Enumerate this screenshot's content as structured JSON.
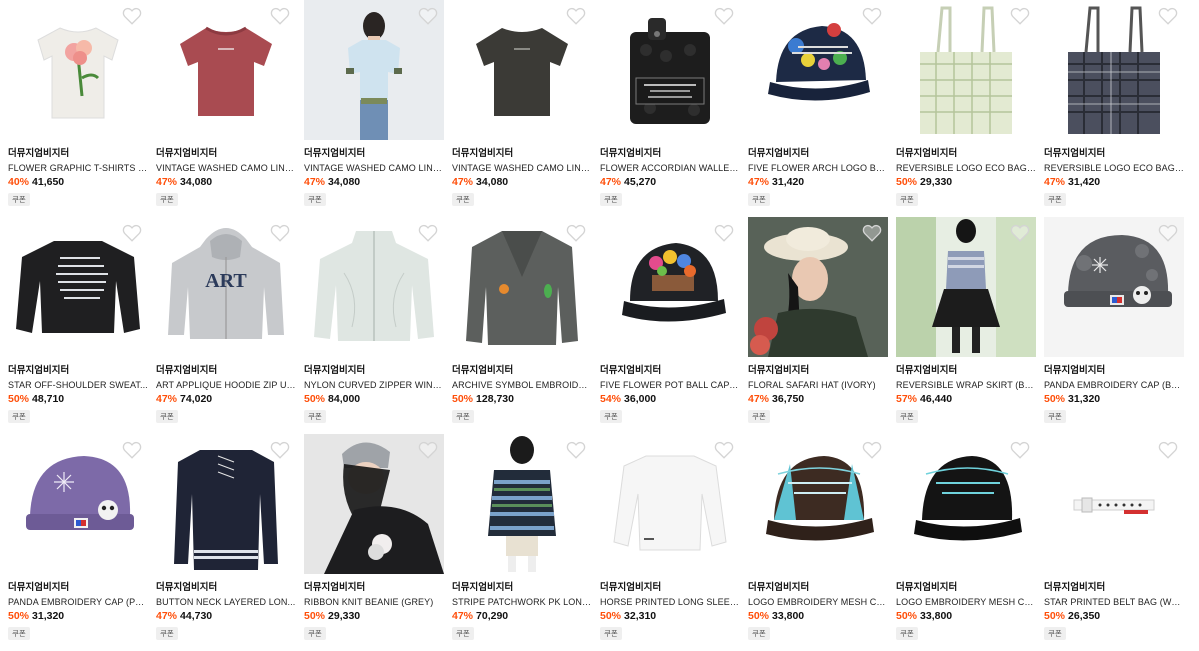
{
  "coupon_label": "쿠폰",
  "products": [
    {
      "brand": "더뮤지엄비지터",
      "name": "FLOWER GRAPHIC T-SHIRTS (...",
      "discount": "40%",
      "price": "41,650",
      "art": "tee-flower"
    },
    {
      "brand": "더뮤지엄비지터",
      "name": "VINTAGE WASHED CAMO LINE...",
      "discount": "47%",
      "price": "34,080",
      "art": "tee-red"
    },
    {
      "brand": "더뮤지엄비지터",
      "name": "VINTAGE WASHED CAMO LINE...",
      "discount": "47%",
      "price": "34,080",
      "art": "model-tee"
    },
    {
      "brand": "더뮤지엄비지터",
      "name": "VINTAGE WASHED CAMO LINE...",
      "discount": "47%",
      "price": "34,080",
      "art": "tee-charcoal"
    },
    {
      "brand": "더뮤지엄비지터",
      "name": "FLOWER ACCORDIAN WALLET...",
      "discount": "47%",
      "price": "45,270",
      "art": "wallet"
    },
    {
      "brand": "더뮤지엄비지터",
      "name": "FIVE FLOWER ARCH LOGO BA...",
      "discount": "47%",
      "price": "31,420",
      "art": "cap-navy-flowers"
    },
    {
      "brand": "더뮤지엄비지터",
      "name": "REVERSIBLE LOGO ECO BAG (...",
      "discount": "50%",
      "price": "29,330",
      "art": "bag-green"
    },
    {
      "brand": "더뮤지엄비지터",
      "name": "REVERSIBLE LOGO ECO BAG (...",
      "discount": "47%",
      "price": "31,420",
      "art": "bag-navy"
    },
    {
      "brand": "더뮤지엄비지터",
      "name": "STAR OFF-SHOULDER SWEAT...",
      "discount": "50%",
      "price": "48,710",
      "art": "sweat-black"
    },
    {
      "brand": "더뮤지엄비지터",
      "name": "ART APPLIQUE HOODIE ZIP UP...",
      "discount": "47%",
      "price": "74,020",
      "art": "hoodie-art"
    },
    {
      "brand": "더뮤지엄비지터",
      "name": "NYLON CURVED ZIPPER WIND...",
      "discount": "50%",
      "price": "84,000",
      "art": "jacket-mint"
    },
    {
      "brand": "더뮤지엄비지터",
      "name": "ARCHIVE SYMBOL EMBROIDE...",
      "discount": "50%",
      "price": "128,730",
      "art": "blazer"
    },
    {
      "brand": "더뮤지엄비지터",
      "name": "FIVE FLOWER POT BALL CAP (...",
      "discount": "54%",
      "price": "36,000",
      "art": "cap-flowerpot"
    },
    {
      "brand": "더뮤지엄비지터",
      "name": "FLORAL SAFARI HAT (IVORY)",
      "discount": "47%",
      "price": "36,750",
      "art": "model-hat"
    },
    {
      "brand": "더뮤지엄비지터",
      "name": "REVERSIBLE WRAP SKIRT (BLA...",
      "discount": "57%",
      "price": "46,440",
      "art": "model-skirt"
    },
    {
      "brand": "더뮤지엄비지터",
      "name": "PANDA EMBROIDERY CAP (BL...",
      "discount": "50%",
      "price": "31,320",
      "art": "cap-panda-grey"
    },
    {
      "brand": "더뮤지엄비지터",
      "name": "PANDA EMBROIDERY CAP (PU...",
      "discount": "50%",
      "price": "31,320",
      "art": "cap-panda-purple"
    },
    {
      "brand": "더뮤지엄비지터",
      "name": "BUTTON NECK LAYERED LON...",
      "discount": "47%",
      "price": "44,730",
      "art": "longsleeve-navy"
    },
    {
      "brand": "더뮤지엄비지터",
      "name": "RIBBON KNIT BEANIE (GREY)",
      "discount": "50%",
      "price": "29,330",
      "art": "model-beanie"
    },
    {
      "brand": "더뮤지엄비지터",
      "name": "STRIPE PATCHWORK PK LONG...",
      "discount": "47%",
      "price": "70,290",
      "art": "model-stripe"
    },
    {
      "brand": "더뮤지엄비지터",
      "name": "HORSE PRINTED LONG SLEEV...",
      "discount": "50%",
      "price": "32,310",
      "art": "longsleeve-white"
    },
    {
      "brand": "더뮤지엄비지터",
      "name": "LOGO EMBROIDERY MESH CA...",
      "discount": "50%",
      "price": "33,800",
      "art": "cap-mesh-brown"
    },
    {
      "brand": "더뮤지엄비지터",
      "name": "LOGO EMBROIDERY MESH CA...",
      "discount": "50%",
      "price": "33,800",
      "art": "cap-mesh-black"
    },
    {
      "brand": "더뮤지엄비지터",
      "name": "STAR PRINTED BELT BAG (WHI...",
      "discount": "50%",
      "price": "26,350",
      "art": "belt-bag"
    }
  ]
}
